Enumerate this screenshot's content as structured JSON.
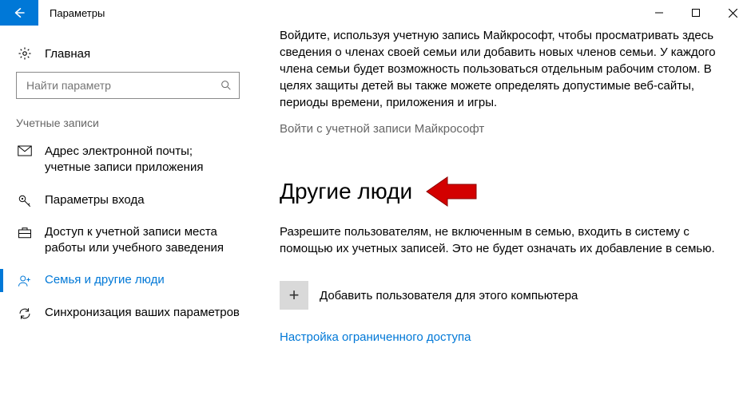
{
  "title": "Параметры",
  "home_label": "Главная",
  "search_placeholder": "Найти параметр",
  "group_label": "Учетные записи",
  "nav": {
    "email": "Адрес электронной почты; учетные записи приложения",
    "signin": "Параметры входа",
    "work": "Доступ к учетной записи места работы или учебного заведения",
    "family": "Семья и другие люди",
    "sync": "Синхронизация ваших параметров"
  },
  "main": {
    "intro": "Войдите, используя учетную запись Майкрософт, чтобы просматривать здесь сведения о членах своей семьи или добавить новых членов семьи. У каждого члена семьи будет возможность пользоваться отдельным рабочим столом. В целях защиты детей вы также можете определять допустимые веб-сайты, периоды времени, приложения и игры.",
    "signin_link": "Войти с учетной записи Майкрософт",
    "other_title": "Другие люди",
    "other_desc": "Разрешите пользователям, не включенным в семью, входить в систему с помощью их учетных записей. Это не будет означать их добавление в семью.",
    "add_label": "Добавить пользователя для этого компьютера",
    "restricted_link": "Настройка ограниченного доступа"
  }
}
